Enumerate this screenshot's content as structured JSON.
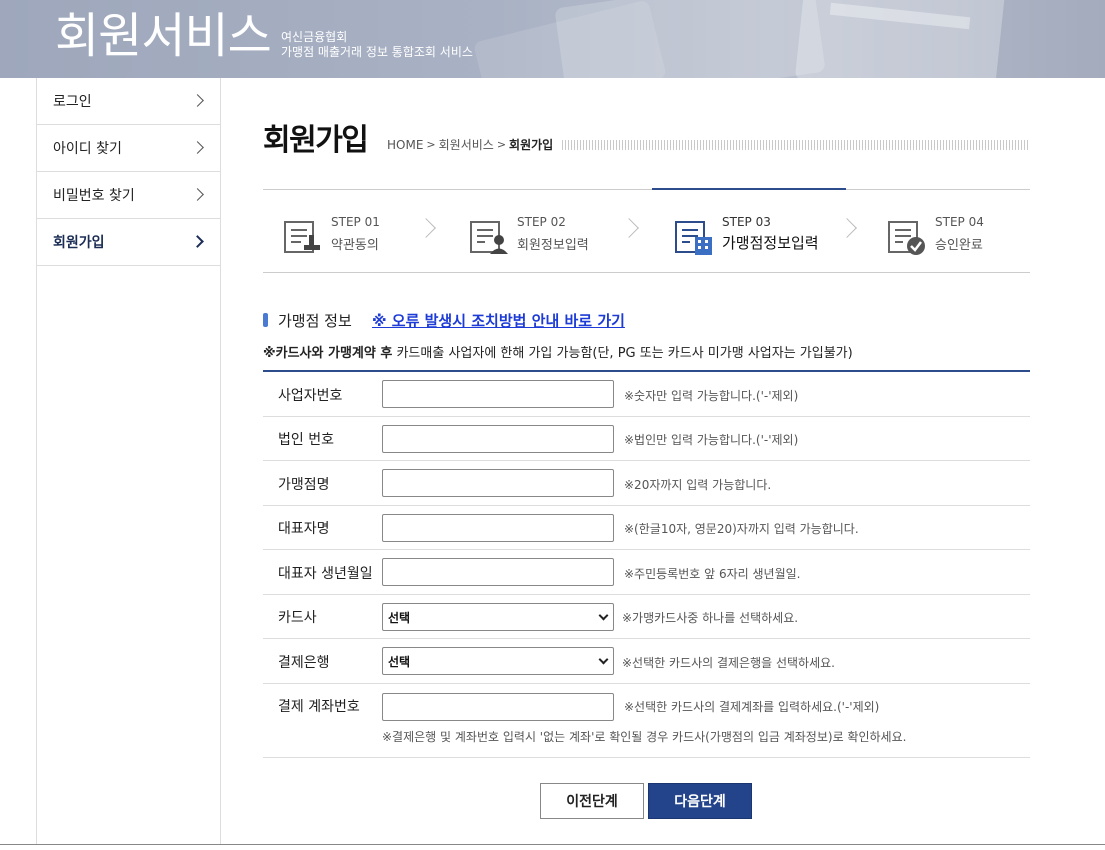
{
  "banner": {
    "title": "회원서비스",
    "subtitle_line1": "여신금융협회",
    "subtitle_line2": "가맹점 매출거래 정보 통합조회 서비스"
  },
  "sidebar": {
    "items": [
      {
        "label": "로그인"
      },
      {
        "label": "아이디 찾기"
      },
      {
        "label": "비밀번호 찾기"
      },
      {
        "label": "회원가입",
        "active": true
      }
    ]
  },
  "page": {
    "title": "회원가입",
    "breadcrumb": [
      "HOME",
      "회원서비스",
      "회원가입"
    ]
  },
  "steps": [
    {
      "num": "STEP 01",
      "label": "약관동의"
    },
    {
      "num": "STEP 02",
      "label": "회원정보입력"
    },
    {
      "num": "STEP 03",
      "label": "가맹점정보입력",
      "active": true
    },
    {
      "num": "STEP 04",
      "label": "승인완료"
    }
  ],
  "section": {
    "title": "가맹점 정보",
    "link": "※ 오류 발생시 조치방법 안내 바로 가기",
    "notice_bold": "※카드사와 가맹계약 후",
    "notice_rest": " 카드매출 사업자에 한해 가입 가능함(단, PG 또는 카드사 미가맹 사업자는 가입불가)"
  },
  "form": {
    "business_number": {
      "label": "사업자번호",
      "value": "",
      "hint": "※숫자만 입력 가능합니다.('-'제외)"
    },
    "corporate_number": {
      "label": "법인 번호",
      "value": "",
      "hint": "※법인만 입력 가능합니다.('-'제외)"
    },
    "merchant_name": {
      "label": "가맹점명",
      "value": "",
      "hint": "※20자까지 입력 가능합니다."
    },
    "representative": {
      "label": "대표자명",
      "value": "",
      "hint": "※(한글10자, 영문20)자까지 입력 가능합니다."
    },
    "birthdate": {
      "label": "대표자 생년월일",
      "value": "",
      "hint": "※주민등록번호 앞 6자리 생년월일."
    },
    "card_company": {
      "label": "카드사",
      "selected": "선택",
      "hint": "※가맹카드사중 하나를 선택하세요."
    },
    "bank": {
      "label": "결제은행",
      "selected": "선택",
      "hint": "※선택한 카드사의 결제은행을 선택하세요."
    },
    "account": {
      "label": "결제 계좌번호",
      "value": "",
      "hint": "※선택한 카드사의 결제계좌를 입력하세요.('-'제외)",
      "hint2": "※결제은행 및 계좌번호 입력시 '없는 계좌'로 확인될 경우 카드사(가맹점의 입금 계좌정보)로 확인하세요."
    }
  },
  "buttons": {
    "prev": "이전단계",
    "next": "다음단계"
  },
  "colors": {
    "accent": "#23448a",
    "link": "#1d3bd6",
    "banner": "#a9b2c4"
  }
}
